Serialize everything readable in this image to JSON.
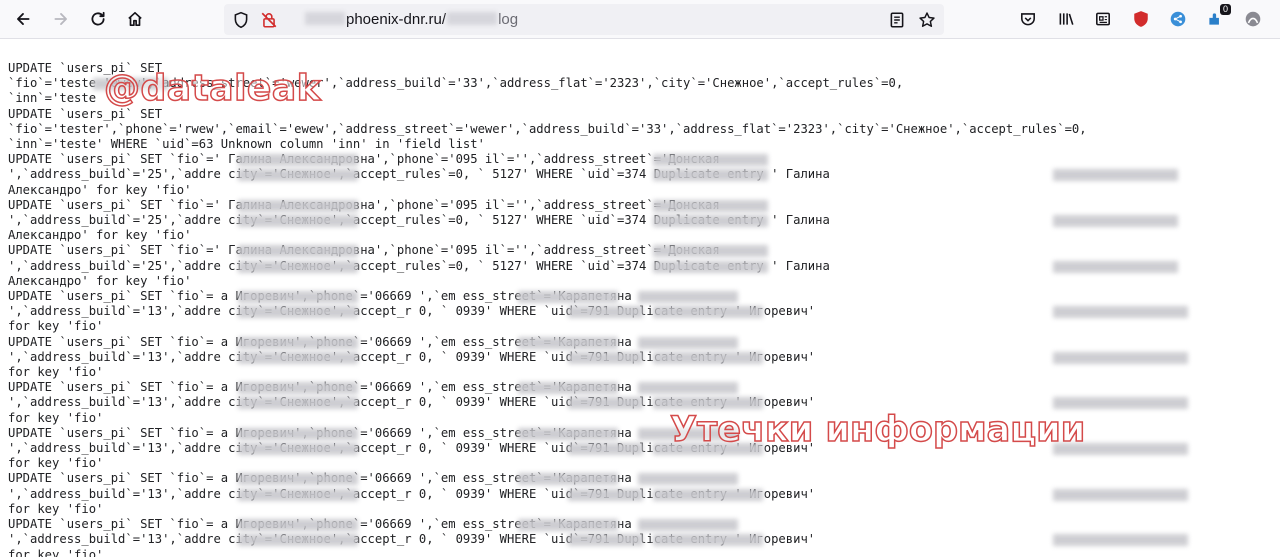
{
  "browser": {
    "url_domain": "phoenix-dnr.ru/",
    "url_path": "log"
  },
  "watermarks": {
    "top": "@dataleak",
    "bottom": "Утечки информации"
  },
  "log_lines": [
    "UPDATE `users_pi` SET",
    "`fio`='teste               'ewew',`address_street`='wewer',`address_build`='33',`address_flat`='2323',`city`='Снежное',`accept_rules`=0,",
    "`inn`='teste",
    "UPDATE `users_pi` SET",
    "`fio`='tester',`phone`='rwew',`email`='ewew',`address_street`='wewer',`address_build`='33',`address_flat`='2323',`city`='Снежное',`accept_rules`=0,",
    "`inn`='teste' WHERE `uid`=63 Unknown column 'inn' in 'field list'",
    "UPDATE `users_pi` SET `fio`='               Галина Александровна',`phone`='095               il`='',`address_street`='Донская",
    "',`address_build`='25',`addre               city`='Снежное',`accept_rules`=0, `               5127' WHERE `uid`=374 Duplicate entry '               Галина",
    "Александро' for key 'fio'",
    "UPDATE `users_pi` SET `fio`='               Галина Александровна',`phone`='095               il`='',`address_street`='Донская",
    "',`address_build`='25',`addre               city`='Снежное',`accept_rules`=0, `               5127' WHERE `uid`=374 Duplicate entry '               Галина",
    "Александро' for key 'fio'",
    "UPDATE `users_pi` SET `fio`='               Галина Александровна',`phone`='095               il`='',`address_street`='Донская",
    "',`address_build`='25',`addre               city`='Снежное',`accept_rules`=0, `               5127' WHERE `uid`=374 Duplicate entry '               Галина",
    "Александро' for key 'fio'",
    "UPDATE `users_pi` SET `fio`=               а Игоревич',`phone`='06669        ',`em               ess_street`='Карапетяна",
    "',`address_build`='13',`addre               city`='Снежное',`accept_r        0, `               0939' WHERE `uid`=791 Duplicate entry '               Игоревич'",
    "for key 'fio'",
    "UPDATE `users_pi` SET `fio`=               а Игоревич',`phone`='06669        ',`em               ess_street`='Карапетяна",
    "',`address_build`='13',`addre               city`='Снежное',`accept_r        0, `               0939' WHERE `uid`=791 Duplicate entry '               Игоревич'",
    "for key 'fio'",
    "UPDATE `users_pi` SET `fio`=               а Игоревич',`phone`='06669        ',`em               ess_street`='Карапетяна",
    "',`address_build`='13',`addre               city`='Снежное',`accept_r        0, `               0939' WHERE `uid`=791 Duplicate entry '               Игоревич'",
    "for key 'fio'",
    "UPDATE `users_pi` SET `fio`=               а Игоревич',`phone`='06669        ',`em               ess_street`='Карапетяна",
    "',`address_build`='13',`addre               city`='Снежное',`accept_r        0, `               0939' WHERE `uid`=791 Duplicate entry '               Игоревич'",
    "for key 'fio'",
    "UPDATE `users_pi` SET `fio`=               а Игоревич',`phone`='06669        ',`em               ess_street`='Карапетяна",
    "',`address_build`='13',`addre               city`='Снежное',`accept_r        0, `               0939' WHERE `uid`=791 Duplicate entry '               Игоревич'",
    "for key 'fio'",
    "UPDATE `users_pi` SET `fio`=               а Игоревич',`phone`='06669        ',`em               ess_street`='Карапетяна",
    "',`address_build`='13',`addre               city`='Снежное',`accept_r        0, `               0939' WHERE `uid`=791 Duplicate entry '               Игоревич'",
    "for key 'fio'"
  ],
  "extension_badge": "0",
  "colors": {
    "watermark": "#d44a4a",
    "toolbar_bg": "#f9f9fb",
    "urlbar_bg": "#f0f0f4"
  }
}
